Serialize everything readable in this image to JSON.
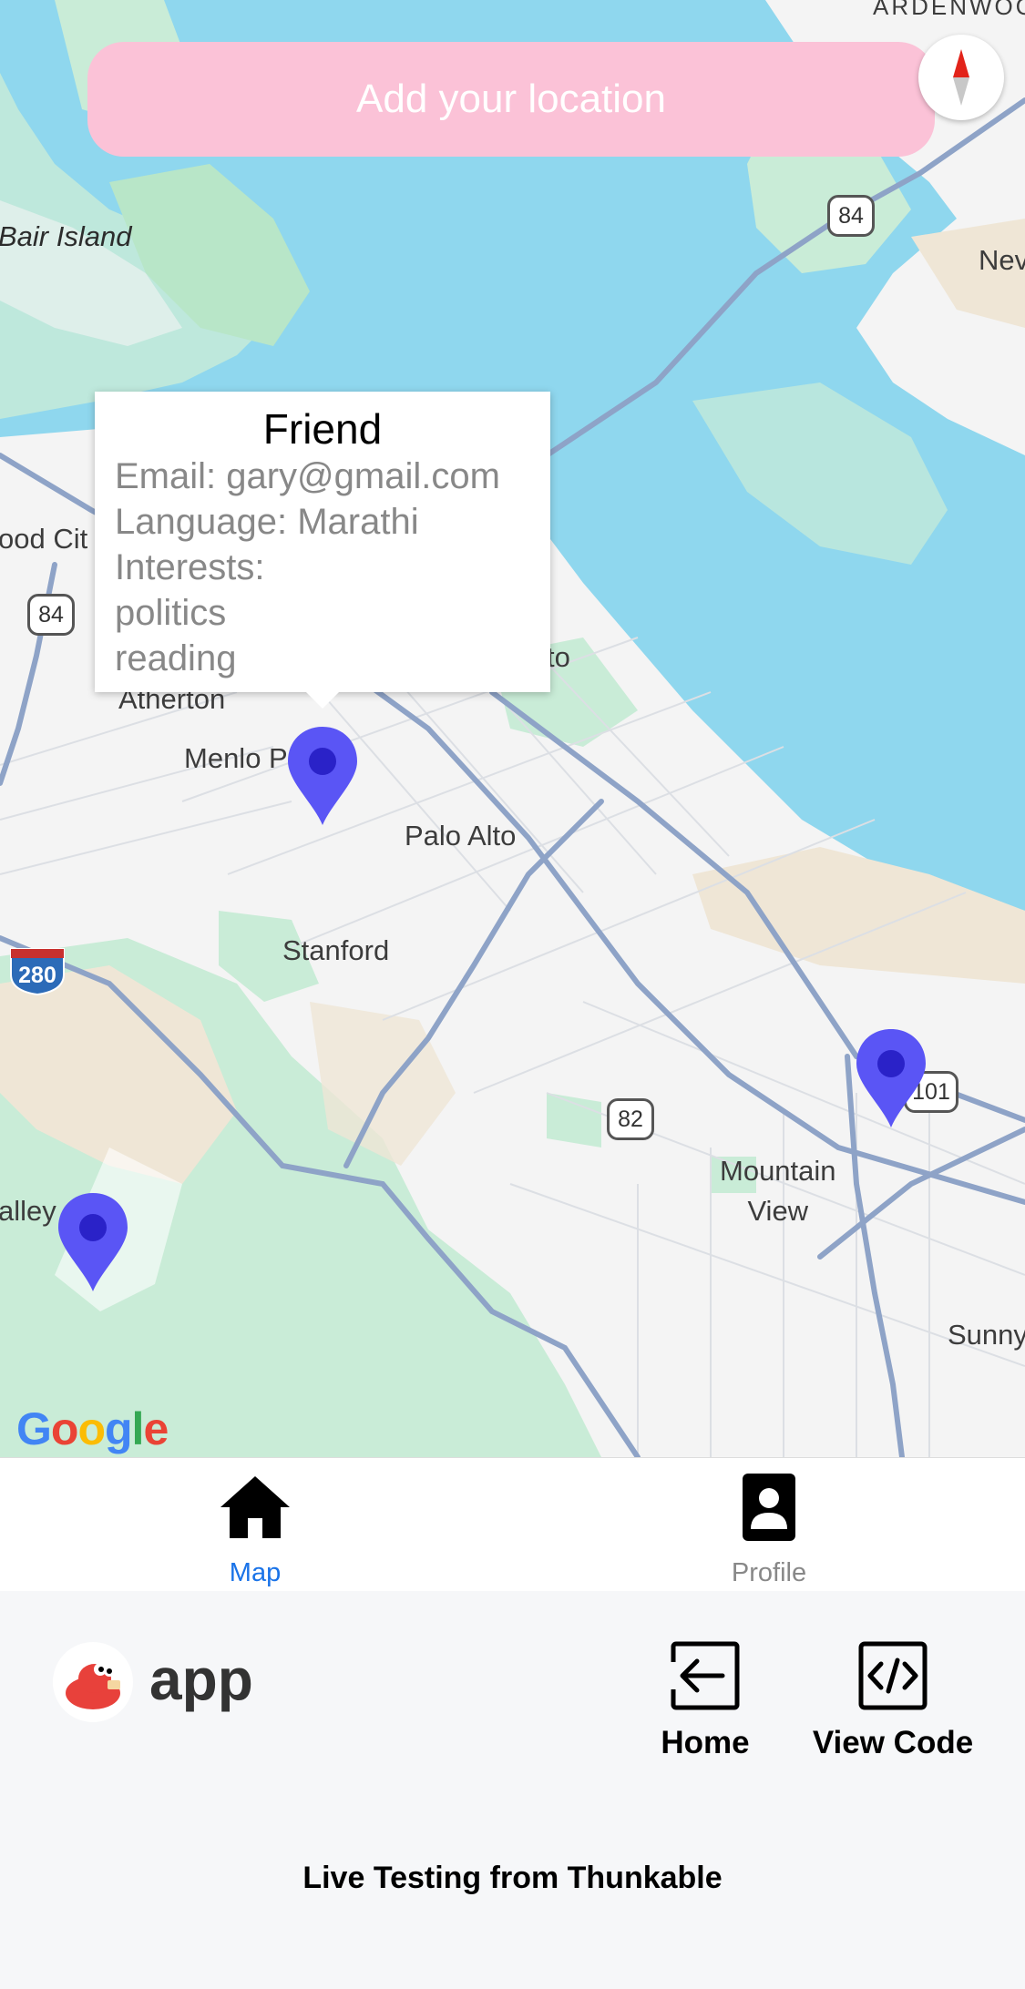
{
  "location_button": {
    "label": "Add your location"
  },
  "map_labels": {
    "ardenwood": "ARDENWOO",
    "bair_island": "Bair Island",
    "newark": "Nev",
    "redwood_city": "ood Cit",
    "atherton": "Atherton",
    "menlo_park": "Menlo P",
    "east_palo_alto": "to",
    "palo_alto": "Palo Alto",
    "stanford": "Stanford",
    "mountain_view": "Mountain\nView",
    "los_altos_hills": "alley",
    "sunnyvale": "Sunny"
  },
  "route_shields": {
    "r84_top": "84",
    "r84_left": "84",
    "r82": "82",
    "us101": "101",
    "i280": "280"
  },
  "callout": {
    "title": "Friend",
    "email": "Email: gary@gmail.com",
    "language": "Language: Marathi",
    "interests_label": "Interests:",
    "interest_1": "politics",
    "interest_2": "reading"
  },
  "google_logo": "Google",
  "tabs": {
    "map": {
      "label": "Map",
      "active": true,
      "color": "#1a73e8"
    },
    "profile": {
      "label": "Profile",
      "active": false,
      "color": "#888888"
    }
  },
  "footer": {
    "app_name": "app",
    "home_label": "Home",
    "view_code_label": "View Code",
    "live_testing": "Live Testing from Thunkable"
  },
  "colors": {
    "pin": "#5a55f5",
    "water": "#8fd7ee",
    "land": "#f4f4f4",
    "park": "#c9ecd7",
    "accent": "#1a73e8"
  }
}
